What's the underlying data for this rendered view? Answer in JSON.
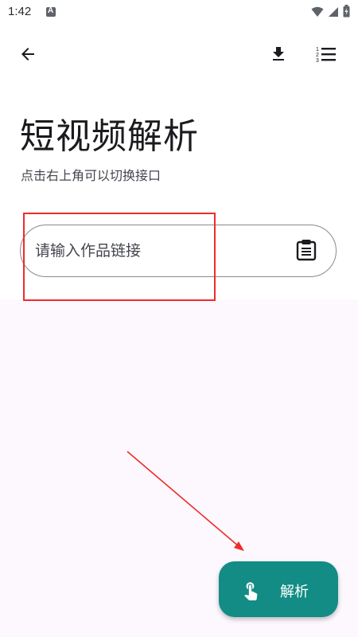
{
  "status_bar": {
    "time": "1:42",
    "app_icon": "a-notification-icon",
    "wifi_icon": "wifi-icon",
    "signal_icon": "signal-icon",
    "battery_icon": "battery-icon"
  },
  "toolbar": {
    "back_icon": "arrow-left-icon",
    "download_icon": "download-icon",
    "list_icon": "numbered-list-icon"
  },
  "header": {
    "title": "短视频解析",
    "subtitle": "点击右上角可以切换接口"
  },
  "link_input": {
    "placeholder": "请输入作品链接",
    "value": "",
    "paste_icon": "clipboard-icon"
  },
  "fab": {
    "label": "解析",
    "icon": "touch-app-icon"
  },
  "colors": {
    "accent": "#128c84",
    "background": "#ffffff",
    "content_background": "#fcf8fe",
    "annotation": "#ef2b2b"
  }
}
